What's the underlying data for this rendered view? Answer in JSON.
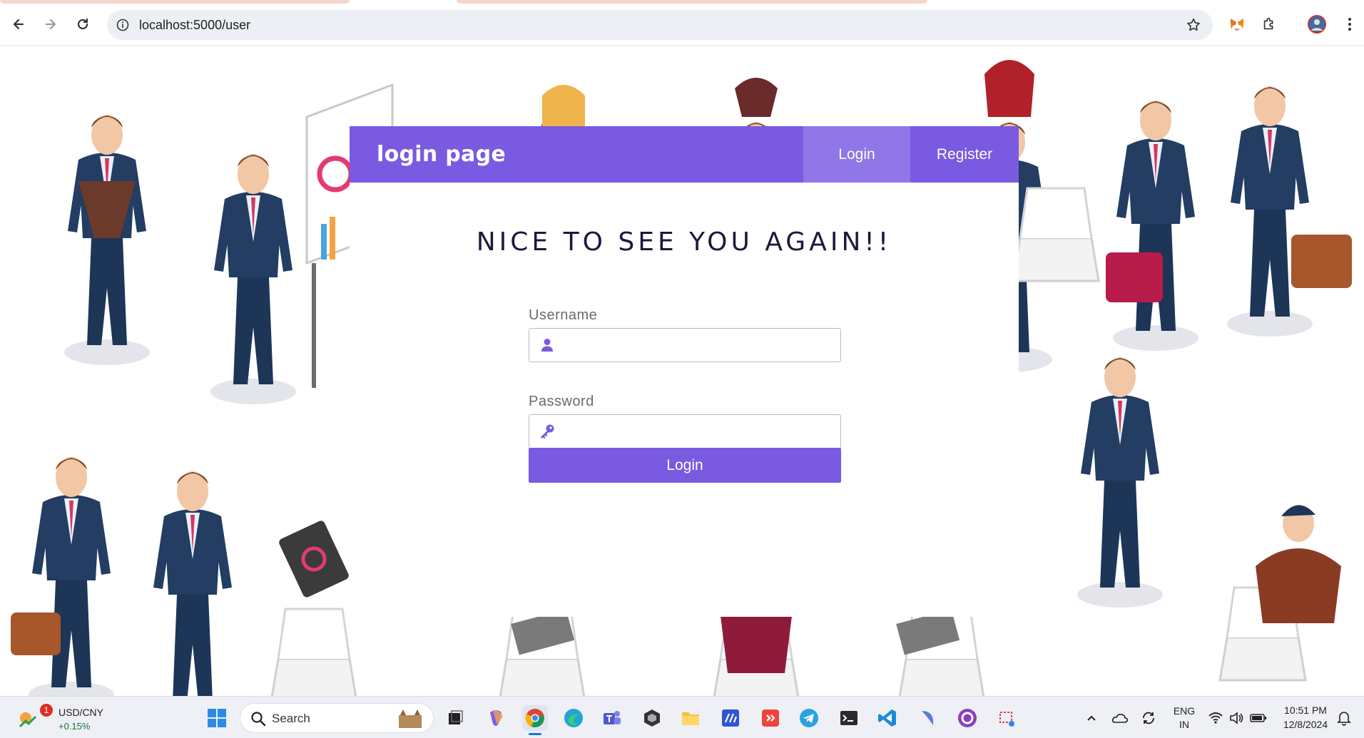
{
  "browser": {
    "url": "localhost:5000/user",
    "back_icon": "back-arrow-icon",
    "forward_icon": "forward-arrow-icon",
    "reload_icon": "reload-icon",
    "info_icon": "site-info-icon",
    "star_icon": "bookmark-star-icon",
    "extensions": [
      "metamask-icon",
      "extensions-puzzle-icon",
      "profile-avatar-icon",
      "menu-kebab-icon"
    ]
  },
  "card": {
    "brand": "login page",
    "nav": {
      "login": "Login",
      "register": "Register"
    },
    "heading": "NICE TO SEE YOU AGAIN!!",
    "username_label": "Username",
    "username_value": "",
    "password_label": "Password",
    "password_value": "",
    "submit": "Login"
  },
  "colors": {
    "accent": "#7a5ae0",
    "nav_active": "#9077e8",
    "heading": "#1a1a3e"
  },
  "taskbar": {
    "ticker_name": "USD/CNY",
    "ticker_change": "+0.15%",
    "ticker_badge": "1",
    "search_label": "Search",
    "language_top": "ENG",
    "language_bottom": "IN",
    "time": "10:51 PM",
    "date": "12/8/2024",
    "apps": [
      "windows-start-icon",
      "search-icon",
      "task-view-icon",
      "copilot-icon",
      "chrome-icon",
      "edge-icon",
      "teams-icon",
      "unity-icon",
      "file-explorer-icon",
      "app-icon",
      "anydesk-icon",
      "telegram-icon",
      "terminal-icon",
      "vscode-icon",
      "app-icon",
      "github-desktop-icon",
      "snipping-tool-icon"
    ],
    "tray": [
      "chevron-up-icon",
      "onedrive-icon",
      "sync-icon",
      "wifi-icon",
      "speaker-icon",
      "battery-icon",
      "notification-bell-icon"
    ]
  }
}
